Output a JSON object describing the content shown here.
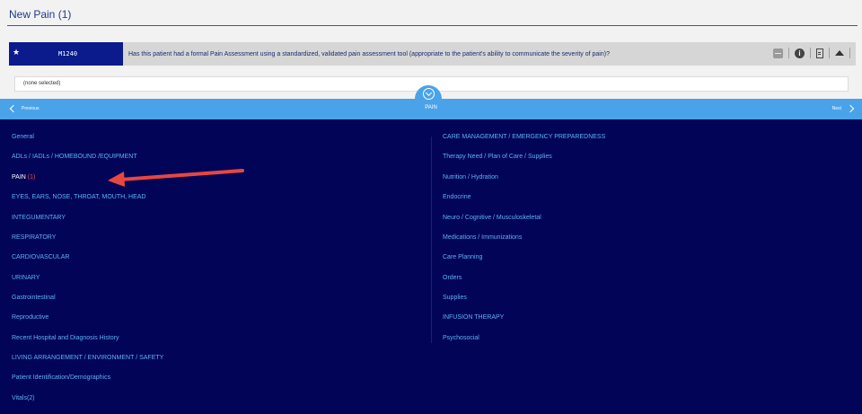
{
  "section": {
    "title": "New Pain (1)"
  },
  "question": {
    "code": "M1240",
    "text": "Has this patient had a formal Pain Assessment using a standardized, validated pain assessment tool (appropriate to the patient's ability to communicate the severity of pain)?",
    "answer": "(none selected)",
    "icons": [
      "minus-icon",
      "info-icon",
      "document-icon",
      "collapse-up-icon"
    ]
  },
  "nav": {
    "previous_label": "Previous",
    "title": "PAIN",
    "next_label": "Next"
  },
  "menu": {
    "left": [
      {
        "label": "General"
      },
      {
        "label": "ADLs / IADLs / HOMEBOUND /EQUIPMENT"
      },
      {
        "label": "PAIN",
        "count": "(1)",
        "active": true
      },
      {
        "label": "EYES, EARS, NOSE, THROAT, MOUTH, HEAD"
      },
      {
        "label": "INTEGUMENTARY"
      },
      {
        "label": "RESPIRATORY"
      },
      {
        "label": "CARDIOVASCULAR"
      },
      {
        "label": "URINARY"
      },
      {
        "label": "Gastrointestinal"
      },
      {
        "label": "Reproductive"
      },
      {
        "label": "Recent Hospital and Diagnosis History"
      },
      {
        "label": "LIVING ARRANGEMENT / ENVIRONMENT / SAFETY"
      },
      {
        "label": "Patient Identification/Demographics"
      },
      {
        "label": "Vitals(2)"
      }
    ],
    "right": [
      {
        "label": "CARE MANAGEMENT / EMERGENCY PREPAREDNESS"
      },
      {
        "label": "Therapy Need / Plan of Care / Supplies"
      },
      {
        "label": "Nutrition / Hydration"
      },
      {
        "label": "Endocrine"
      },
      {
        "label": "Neuro / Cognitive / Musculoskeletal"
      },
      {
        "label": "Medications / Immunizations"
      },
      {
        "label": "Care Planning"
      },
      {
        "label": "Orders"
      },
      {
        "label": "Supplies"
      },
      {
        "label": "INFUSION THERAPY"
      },
      {
        "label": "Psychosocial"
      }
    ]
  },
  "colors": {
    "panel": "#020458",
    "nav": "#4aa3e9",
    "link": "#5cb3f2",
    "active": "#ffffff",
    "count": "#e8473f",
    "annotation_arrow": "#e8473f"
  }
}
